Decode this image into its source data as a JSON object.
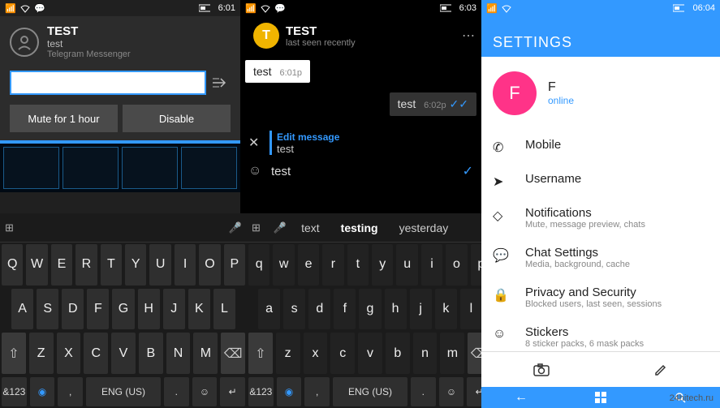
{
  "watermark": "24hitech.ru",
  "pane1": {
    "status": {
      "time": "6:01"
    },
    "notif": {
      "title": "TEST",
      "subtitle": "test",
      "app": "Telegram Messenger",
      "reply_placeholder": "",
      "mute_label": "Mute for 1 hour",
      "disable_label": "Disable"
    }
  },
  "pane2": {
    "status": {
      "time": "6:03"
    },
    "chat": {
      "avatar_letter": "T",
      "title": "TEST",
      "subtitle": "last seen recently",
      "msg_in": {
        "text": "test",
        "time": "6:01p"
      },
      "msg_out": {
        "text": "test",
        "time": "6:02p"
      },
      "edit_label": "Edit message",
      "edit_text": "test",
      "compose_text": "test"
    }
  },
  "keyboard": {
    "suggestions": [
      "text",
      "testing",
      "yesterday"
    ],
    "row1": [
      "Q",
      "W",
      "E",
      "R",
      "T",
      "Y",
      "U",
      "I",
      "O",
      "P"
    ],
    "row1b": [
      "q",
      "w",
      "e",
      "r",
      "t",
      "y",
      "u",
      "i",
      "o",
      "p"
    ],
    "row2": [
      "A",
      "S",
      "D",
      "F",
      "G",
      "H",
      "J",
      "K",
      "L"
    ],
    "row2b": [
      "a",
      "s",
      "d",
      "f",
      "g",
      "h",
      "j",
      "k",
      "l"
    ],
    "row3": [
      "Z",
      "X",
      "C",
      "V",
      "B",
      "N",
      "M"
    ],
    "row3b": [
      "z",
      "x",
      "c",
      "v",
      "b",
      "n",
      "m"
    ],
    "bottom": {
      "numkey": "&123",
      "lang": "ENG (US)",
      "period": ".",
      "comma": ","
    }
  },
  "pane3": {
    "status": {
      "time": "06:04"
    },
    "header": "SETTINGS",
    "profile": {
      "avatar_letter": "F",
      "name": "F",
      "status": "online"
    },
    "items": [
      {
        "title": "Mobile",
        "sub": ""
      },
      {
        "title": "Username",
        "sub": ""
      },
      {
        "title": "Notifications",
        "sub": "Mute, message preview, chats"
      },
      {
        "title": "Chat Settings",
        "sub": "Media, background, cache"
      },
      {
        "title": "Privacy and Security",
        "sub": "Blocked users, last seen, sessions"
      },
      {
        "title": "Stickers",
        "sub": "8 sticker packs, 6 mask packs"
      }
    ]
  }
}
